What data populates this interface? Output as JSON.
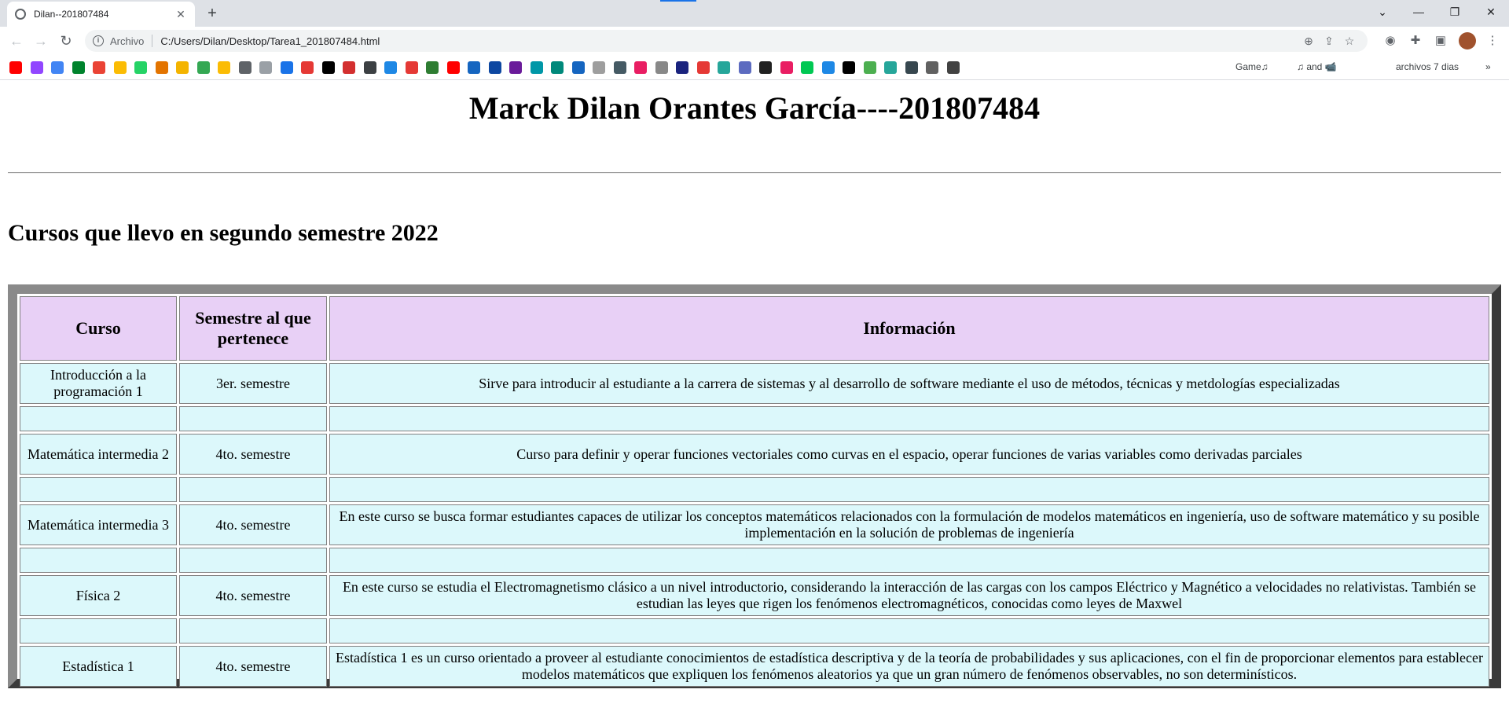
{
  "browser": {
    "tab_title": "Dilan--201807484",
    "url_scheme": "Archivo",
    "url": "C:/Users/Dilan/Desktop/Tarea1_201807484.html",
    "bookmarks": [
      {
        "label": "Game♫",
        "color": "#7a6a2a"
      },
      {
        "label": "♫ and 📹",
        "color": "#222222"
      },
      {
        "label": "archivos 7 dias",
        "color": "#111111"
      }
    ],
    "bookmark_icon_colors": [
      "#ff0000",
      "#9146ff",
      "#4285f4",
      "#00832d",
      "#ea4335",
      "#fbbc04",
      "#25d366",
      "#e37400",
      "#f4b400",
      "#34a853",
      "#fbbc04",
      "#5f6368",
      "#9aa0a6",
      "#1a73e8",
      "#e53935",
      "#000000",
      "#d32f2f",
      "#3c4043",
      "#1e88e5",
      "#e53935",
      "#2e7d32",
      "#ff0000",
      "#1565c0",
      "#0d47a1",
      "#6a1b9a",
      "#0097a7",
      "#00897b",
      "#1565c0",
      "#9e9e9e",
      "#455a64",
      "#e91e63",
      "#888888",
      "#1a237e",
      "#e53935",
      "#26a69a",
      "#5c6bc0",
      "#212121",
      "#e91e63",
      "#00c853",
      "#1e88e5",
      "#000000",
      "#4caf50",
      "#26a69a",
      "#37474f",
      "#616161",
      "#424242"
    ]
  },
  "page": {
    "title": "Marck Dilan Orantes García----201807484",
    "subtitle": "Cursos que llevo en segundo semestre 2022",
    "table": {
      "headers": [
        "Curso",
        "Semestre al que pertenece",
        "Información"
      ],
      "rows": [
        {
          "curso": "Introducción a la programación 1",
          "semestre": "3er. semestre",
          "info": "Sirve para introducir al estudiante a la carrera de sistemas y al desarrollo de software mediante el uso de métodos, técnicas y metdologías especializadas"
        },
        {
          "curso": "Matemática intermedia 2",
          "semestre": "4to. semestre",
          "info": "Curso para definir y operar funciones vectoriales como curvas en el espacio, operar funciones de varias variables como derivadas parciales"
        },
        {
          "curso": "Matemática intermedia 3",
          "semestre": "4to. semestre",
          "info": "En este curso se busca formar estudiantes capaces de utilizar los conceptos matemáticos relacionados con la formulación de modelos matemáticos en ingeniería, uso de software matemático y su posible implementación en la solución de problemas de ingeniería"
        },
        {
          "curso": "Física 2",
          "semestre": "4to. semestre",
          "info": "En este curso se estudia el Electromagnetismo clásico a un nivel introductorio, considerando la interacción de las cargas con los campos Eléctrico y Magnético a velocidades no relativistas. También se estudian las leyes que rigen los fenómenos electromagnéticos, conocidas como leyes de Maxwel"
        },
        {
          "curso": "Estadística 1",
          "semestre": "4to. semestre",
          "info": "Estadística 1 es un curso orientado a proveer al estudiante conocimientos de estadística descriptiva y de la teoría de probabilidades y sus aplicaciones, con el fin de proporcionar elementos para establecer modelos matemáticos que expliquen los fenómenos aleatorios ya que un gran número de fenómenos observables, no son determinísticos."
        }
      ]
    }
  }
}
